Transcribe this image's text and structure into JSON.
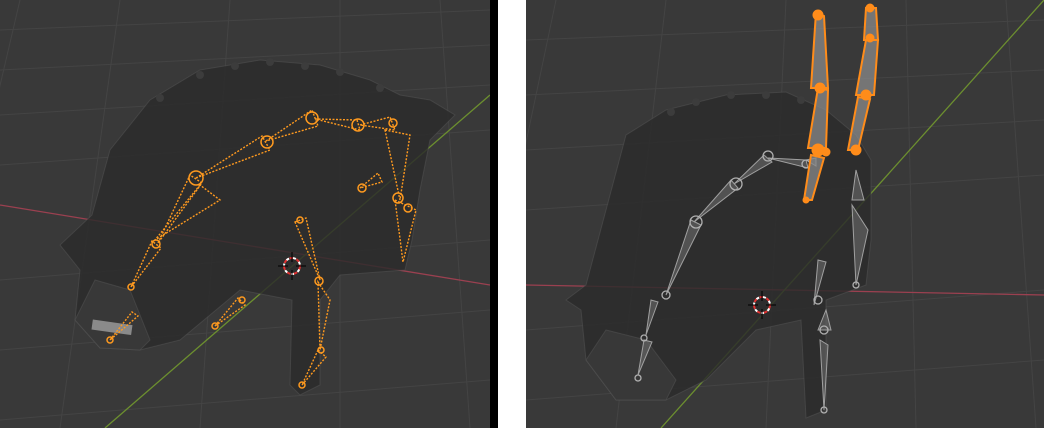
{
  "viewports": [
    {
      "id": "left",
      "view": "3d-viewport",
      "mode": "pose",
      "armature_state": "all-bones-selected",
      "bone_color": "#ff8c1a"
    },
    {
      "id": "right",
      "view": "3d-viewport",
      "mode": "pose",
      "armature_state": "two-leg-chains-selected-and-raised",
      "bone_color": "#ff8c1a",
      "unselected_bone_color": "#9a9a9a"
    }
  ],
  "colors": {
    "background": "#393939",
    "grid_line": "#444444",
    "x_axis": "#9b4050",
    "y_axis": "#6c8f2f",
    "mesh": "#2d2d2d",
    "cursor_red": "#e03030",
    "cursor_white": "#ffffff"
  },
  "icons": [
    "3d-cursor-icon",
    "3d-cursor-icon"
  ]
}
